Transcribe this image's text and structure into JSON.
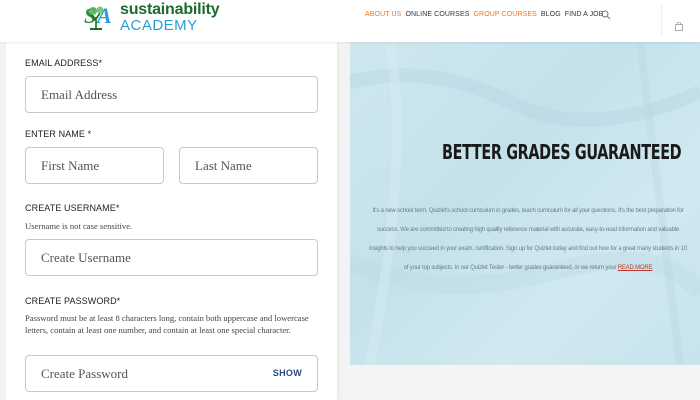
{
  "header": {
    "logo_line1": "sustainability",
    "logo_line2": "ACADEMY",
    "nav": [
      {
        "label": "ABOUT US",
        "accent": true
      },
      {
        "label": "ONLINE COURSES",
        "accent": false
      },
      {
        "label": "GROUP COURSES",
        "accent": true
      },
      {
        "label": "BLOG",
        "accent": false
      },
      {
        "label": "FIND A JOB",
        "accent": false
      }
    ]
  },
  "form": {
    "email": {
      "label": "EMAIL ADDRESS*",
      "placeholder": "Email Address"
    },
    "name": {
      "label": "ENTER NAME *",
      "first_placeholder": "First Name",
      "last_placeholder": "Last Name"
    },
    "username": {
      "label": "CREATE USERNAME*",
      "hint": "Username is not case sensitive.",
      "placeholder": "Create Username"
    },
    "password": {
      "label": "CREATE PASSWORD*",
      "hint": "Password must be at least 8 characters long, contain both uppercase and lowercase letters, contain at least one number, and contain at least one special character.",
      "placeholder": "Create Password",
      "show_label": "SHOW"
    }
  },
  "hero": {
    "title": "BETTER GRADES GUARANTEED",
    "body": "It's a new school term, Quizlet's school curriculum in grades, teach curriculum for all your questions. It's the best preparation for success. We are committed to creating high quality reference material with accurate, easy-to-read information and valuable insights to help you succeed in your exam, certification. Sign up for Quizlet today and find out how for a great many students in 10 of your top subjects. In our Quizlet Tester - better grades guaranteed, or we return your ",
    "link": "READ MORE"
  },
  "colors": {
    "accent_orange": "#e87722",
    "logo_green": "#1c6b2e",
    "logo_blue": "#2a9fd6",
    "show_blue": "#2c4a7a",
    "hero_bg": "#cfe7ef"
  }
}
